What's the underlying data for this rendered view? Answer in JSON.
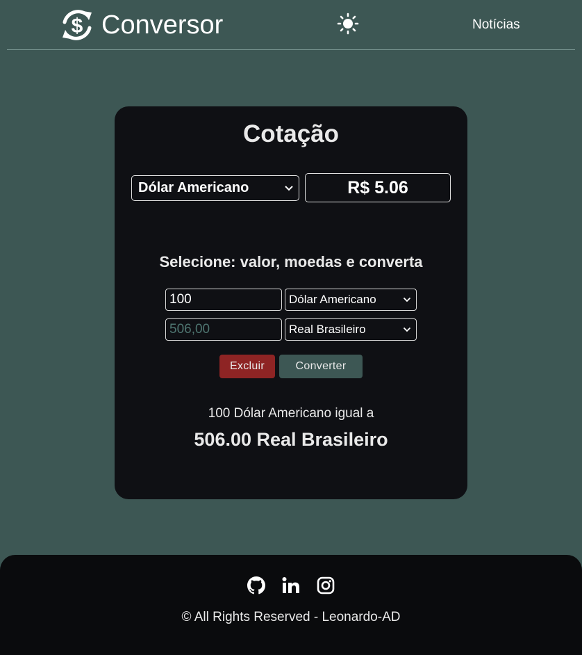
{
  "header": {
    "brand_icon": "dollar-exchange-icon",
    "brand_name": "Conversor",
    "theme_icon": "sun-icon",
    "nav_news": "Notícias"
  },
  "quote": {
    "title": "Cotação",
    "currency": "Dólar Americano",
    "value": "R$ 5.06"
  },
  "converter": {
    "instruction": "Selecione: valor, moedas e converta",
    "amount": "100",
    "result_placeholder": "506,00",
    "from_currency": "Dólar Americano",
    "to_currency": "Real Brasileiro",
    "delete_label": "Excluir",
    "convert_label": "Converter",
    "result_line1": "100 Dólar Americano igual a",
    "result_line2": "506.00 Real Brasileiro"
  },
  "footer": {
    "social_icons": [
      "github-icon",
      "linkedin-icon",
      "instagram-icon"
    ],
    "copyright": "© All Rights Reserved - Leonardo-AD"
  },
  "colors": {
    "background": "#3d5754",
    "card": "#0f1014",
    "footer": "#0a0b0d",
    "delete_button": "#8e2424",
    "convert_button": "#3d5754",
    "text": "#e9e9e9"
  }
}
